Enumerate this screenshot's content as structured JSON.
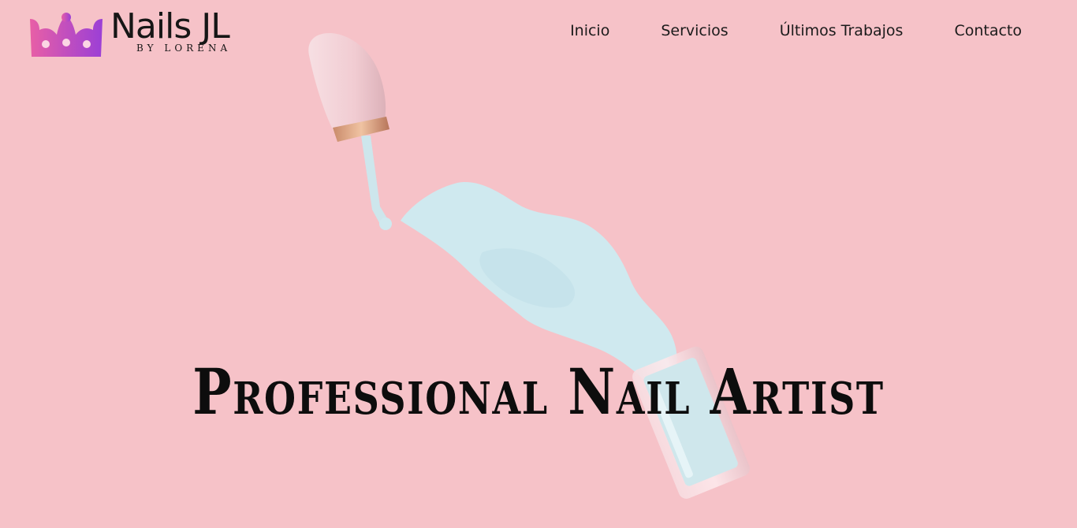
{
  "brand": {
    "name": "Nails JL",
    "tagline": "BY LORENA",
    "crown_gradient": [
      "#e85fa6",
      "#9b3fd6"
    ]
  },
  "nav": {
    "items": [
      {
        "label": "Inicio"
      },
      {
        "label": "Servicios"
      },
      {
        "label": "Últimos Trabajos"
      },
      {
        "label": "Contacto"
      }
    ]
  },
  "hero": {
    "headline": "Professional Nail Artist",
    "background_color": "#f6c2c8",
    "polish_color": "#cfeaf0",
    "cap_color": "#f3d1d6"
  }
}
